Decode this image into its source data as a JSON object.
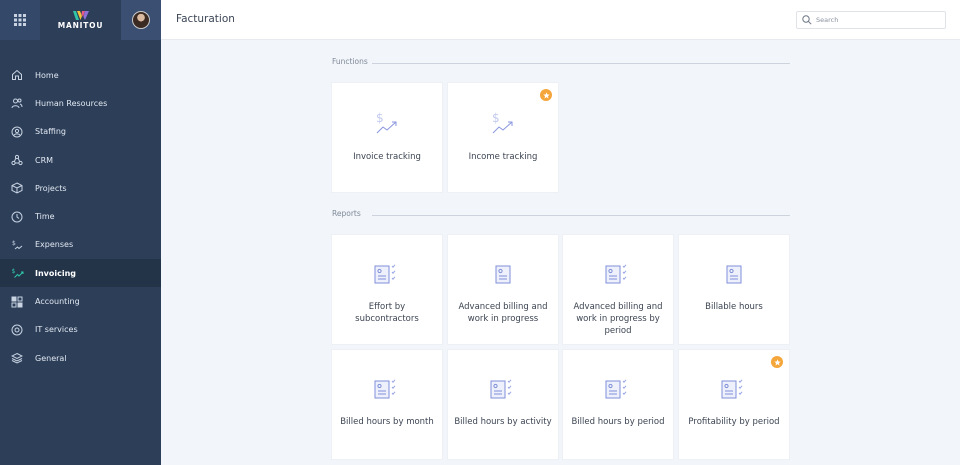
{
  "app": {
    "logo_text": "MANITOU",
    "page_title": "Facturation"
  },
  "search": {
    "placeholder": "Search"
  },
  "sidebar": {
    "items": [
      {
        "label": "Home",
        "icon": "home-icon",
        "active": false
      },
      {
        "label": "Human Resources",
        "icon": "people-icon",
        "active": false
      },
      {
        "label": "Staffing",
        "icon": "staffing-icon",
        "active": false
      },
      {
        "label": "CRM",
        "icon": "crm-icon",
        "active": false
      },
      {
        "label": "Projects",
        "icon": "cube-icon",
        "active": false
      },
      {
        "label": "Time",
        "icon": "clock-icon",
        "active": false
      },
      {
        "label": "Expenses",
        "icon": "expenses-icon",
        "active": false
      },
      {
        "label": "Invoicing",
        "icon": "invoicing-icon",
        "active": true
      },
      {
        "label": "Accounting",
        "icon": "accounting-icon",
        "active": false
      },
      {
        "label": "IT services",
        "icon": "it-services-icon",
        "active": false
      },
      {
        "label": "General",
        "icon": "layers-icon",
        "active": false
      }
    ]
  },
  "functions": {
    "title": "Functions",
    "cards": [
      {
        "label": "Invoice tracking",
        "icon": "dollar-trend-icon",
        "favorite": false
      },
      {
        "label": "Income tracking",
        "icon": "dollar-trend-icon",
        "favorite": true
      }
    ]
  },
  "reports": {
    "title": "Reports",
    "cards": [
      {
        "label": "Effort by subcontractors",
        "icon": "report-checklist-icon",
        "favorite": false
      },
      {
        "label": "Advanced billing and work in progress",
        "icon": "report-doc-icon",
        "favorite": false
      },
      {
        "label": "Advanced billing and work in progress by period",
        "icon": "report-checklist-icon",
        "favorite": false
      },
      {
        "label": "Billable hours",
        "icon": "report-doc-icon",
        "favorite": false
      },
      {
        "label": "Billed hours by month",
        "icon": "report-checklist-icon",
        "favorite": false
      },
      {
        "label": "Billed hours by activity",
        "icon": "report-checklist-icon",
        "favorite": false
      },
      {
        "label": "Billed hours by period",
        "icon": "report-checklist-icon",
        "favorite": false
      },
      {
        "label": "Profitability by period",
        "icon": "report-checklist-icon",
        "favorite": true
      }
    ]
  },
  "colors": {
    "sidebar": "#2c3e58",
    "sidebar_active": "#233449",
    "accent_green": "#2fc7a8",
    "favorite": "#f5a63b",
    "icon_blue": "#7f8fd8"
  }
}
